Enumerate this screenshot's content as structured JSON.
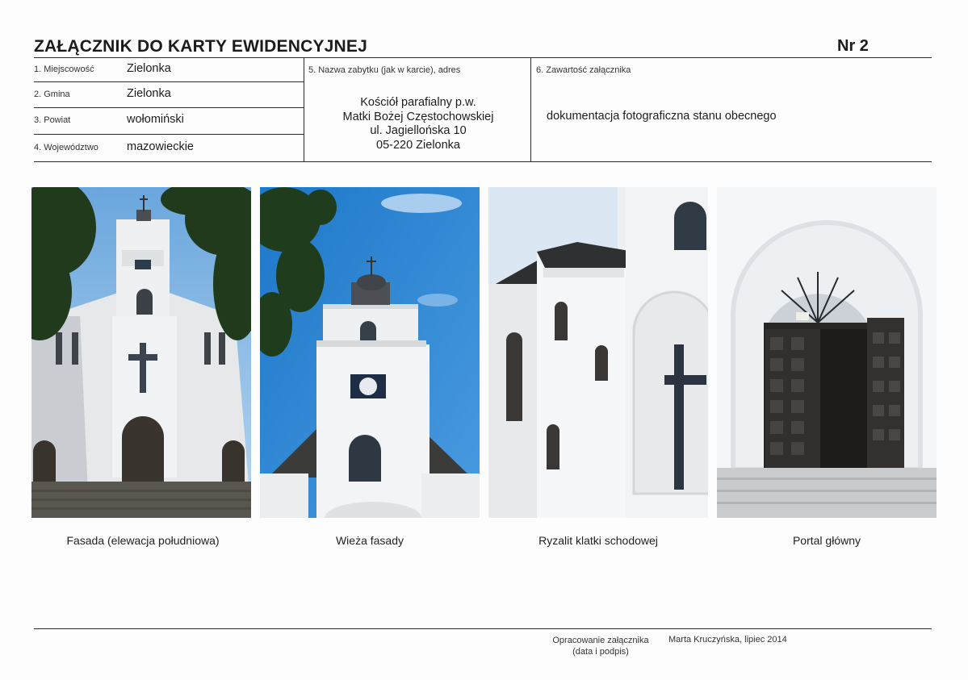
{
  "header": {
    "title": "ZAŁĄCZNIK DO KARTY EWIDENCYJNEJ",
    "number": "Nr  2"
  },
  "fields": {
    "miejscowosc": {
      "label": "1. Miejscowość",
      "value": "Zielonka"
    },
    "gmina": {
      "label": "2. Gmina",
      "value": "Zielonka"
    },
    "powiat": {
      "label": "3. Powiat",
      "value": "wołomiński"
    },
    "wojewodztwo": {
      "label": "4. Województwo",
      "value": "mazowieckie"
    },
    "nazwa": {
      "label": "5. Nazwa zabytku (jak w karcie), adres",
      "lines": [
        "Kościół parafialny p.w.",
        "Matki Bożej Częstochowskiej",
        "ul. Jagiellońska 10",
        "05-220 Zielonka"
      ]
    },
    "zawartosc": {
      "label": "6. Zawartość załącznika",
      "value": "dokumentacja fotograficzna stanu obecnego"
    }
  },
  "photos": [
    {
      "caption": "Fasada (elewacja południowa)"
    },
    {
      "caption": "Wieża fasady"
    },
    {
      "caption": "Ryzalit klatki schodowej"
    },
    {
      "caption": "Portal główny"
    }
  ],
  "footer": {
    "prepared_label_1": "Opracowanie załącznika",
    "prepared_label_2": "(data i podpis)",
    "author": "Marta Kruczyńska, lipiec 2014"
  }
}
